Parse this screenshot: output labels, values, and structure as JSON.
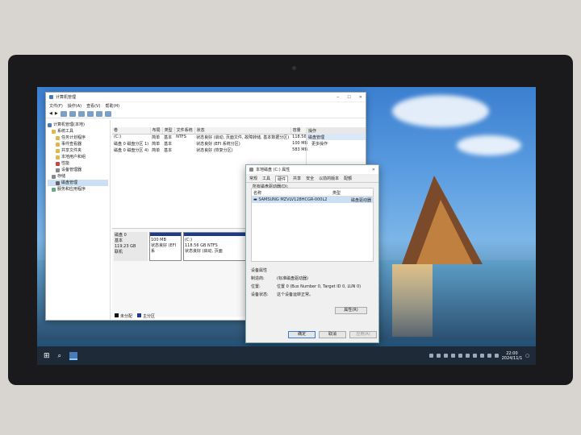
{
  "mmc": {
    "title": "计算机管理",
    "menu": [
      "文件(F)",
      "操作(A)",
      "查看(V)",
      "帮助(H)"
    ],
    "tree": [
      {
        "label": "计算机管理(本地)",
        "level": 0
      },
      {
        "label": "系统工具",
        "level": 1
      },
      {
        "label": "任务计划程序",
        "level": 2
      },
      {
        "label": "事件查看器",
        "level": 2
      },
      {
        "label": "共享文件夹",
        "level": 2
      },
      {
        "label": "本地用户和组",
        "level": 2
      },
      {
        "label": "性能",
        "level": 2
      },
      {
        "label": "设备管理器",
        "level": 2
      },
      {
        "label": "存储",
        "level": 1
      },
      {
        "label": "磁盘管理",
        "level": 2
      },
      {
        "label": "服务和应用程序",
        "level": 1
      }
    ],
    "columns": [
      "卷",
      "布局",
      "类型",
      "文件系统",
      "状态",
      "容量"
    ],
    "volumes": [
      {
        "vol": "(C:)",
        "layout": "简单",
        "type": "基本",
        "fs": "NTFS",
        "status": "状态良好 (启动, 页面文件, 故障转储, 基本数据分区)",
        "size": "118.56 G"
      },
      {
        "vol": "磁盘 0 磁盘分区 1)",
        "layout": "简单",
        "type": "基本",
        "fs": "",
        "status": "状态良好 (EFI 系统分区)",
        "size": "100 MB"
      },
      {
        "vol": "磁盘 0 磁盘分区 4)",
        "layout": "简单",
        "type": "基本",
        "fs": "",
        "status": "状态良好 (恢复分区)",
        "size": "583 MB"
      }
    ],
    "actions": {
      "header": "操作",
      "selected": "磁盘管理",
      "more": "更多操作"
    },
    "disk": {
      "name": "磁盘 0",
      "type": "基本",
      "size": "119.23 GB",
      "state": "联机"
    },
    "partitions": [
      {
        "label": "",
        "size": "100 MB",
        "status": "状态良好 (EFI 系"
      },
      {
        "label": "(C:)",
        "size": "118.56 GB NTFS",
        "status": "状态良好 (启动, 页面"
      }
    ],
    "legend": [
      "未分配",
      "主分区"
    ]
  },
  "dialog": {
    "title": "本地磁盘 (C:) 属性",
    "tabs": [
      "常规",
      "工具",
      "硬件",
      "共享",
      "安全",
      "以前的版本",
      "配额"
    ],
    "selected_tab": "硬件",
    "list_title": "所有磁盘驱动器(D):",
    "list_cols": [
      "名称",
      "类型"
    ],
    "device": {
      "name": "SAMSUNG MZVLV128HCGR-000L2",
      "type": "磁盘驱动器"
    },
    "props_title": "设备属性",
    "props": [
      {
        "k": "制造商:",
        "v": "(标准磁盘驱动器)"
      },
      {
        "k": "位置:",
        "v": "位置 0 (Bus Number 0, Target ID 0, LUN 0)"
      },
      {
        "k": "设备状态:",
        "v": "这个设备运转正常。"
      }
    ],
    "props_button": "属性(R)",
    "ok": "确定",
    "cancel": "取消",
    "apply": "应用(A)"
  },
  "taskbar": {
    "time": "22:00",
    "date": "2024/11/1"
  },
  "colors": {
    "unallocated": "#111111",
    "primary": "#1c3b8e",
    "accent": "#3a7bd5"
  }
}
